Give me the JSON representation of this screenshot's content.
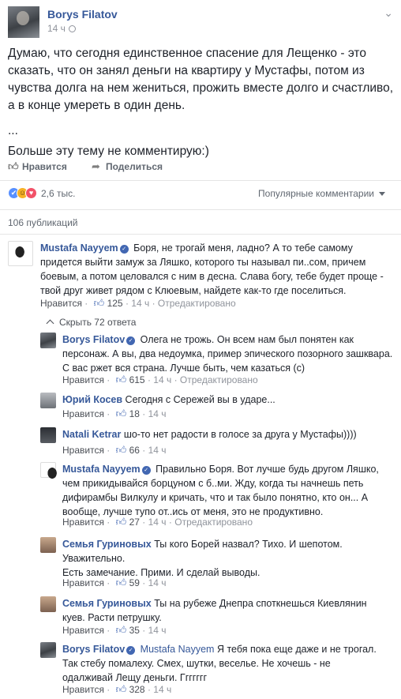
{
  "post": {
    "author": "Borys Filatov",
    "time": "14 ч",
    "paragraph1": "Думаю, что сегодня единственное спасение для Лещенко - это сказать, что он занял деньги на квартиру у Мустафы, потом из чувства долга на нем жениться, прожить вместе долго и счастливо, а в конце умереть в один день.",
    "ellipsis": "...",
    "paragraph2": "Больше эту тему не комментирую:)",
    "like_label": "Нравится",
    "share_label": "Поделиться",
    "reactions_count": "2,6 тыс.",
    "sort_label": "Популярные комментарии",
    "publications_label": "106 публикаций"
  },
  "comments": [
    {
      "author": "Mustafa Nayyem",
      "text": "Боря, не трогай меня, ладно? А то тебе самому придется выйти замуж за Ляшко, которого ты называл пи..сом, причем боевым, а потом целовался с ним в десна. Слава богу, тебе будет проще - твой друг живет рядом с Клюевым, найдете как-то где поселиться.",
      "like": "Нравится",
      "likes": "125",
      "time": "14 ч",
      "edited": "Отредактировано"
    }
  ],
  "hide_replies_label": "Скрыть 72 ответа",
  "replies": [
    {
      "author": "Borys Filatov",
      "text": "Олега не трожь. Он всем нам был понятен как персонаж. А вы, два недоумка, пример эпического позорного зашквара. С вас ржет вся страна. Лучше быть, чем казаться (с)",
      "like": "Нравится",
      "likes": "615",
      "time": "14 ч",
      "edited": "Отредактировано"
    },
    {
      "author": "Юрий Косев",
      "text": "Сегодня с Сережей вы в ударе...",
      "like": "Нравится",
      "likes": "18",
      "time": "14 ч"
    },
    {
      "author": "Natali Ketrar",
      "text": "шо-то нет радости в голосе за друга у Мустафы))))",
      "like": "Нравится",
      "likes": "66",
      "time": "14 ч"
    },
    {
      "author": "Mustafa Nayyem",
      "text": "Правильно Боря. Вот лучше будь другом Ляшко, чем прикидывайся борцуном с б..ми. Жду, когда ты начнешь петь дифирамбы Вилкулу и кричать, что и так было понятно, кто он... А вообще, лучше тупо от..ись от меня, это не продуктивно.",
      "like": "Нравится",
      "likes": "27",
      "time": "14 ч",
      "edited": "Отредактировано"
    },
    {
      "author": "Семья Гуриновых",
      "text": "Ты кого Борей назвал? Тихо. И шепотом. Уважительно.",
      "text2": "Есть замечание. Прими. И сделай выводы.",
      "like": "Нравится",
      "likes": "59",
      "time": "14 ч"
    },
    {
      "author": "Семья Гуриновых",
      "text": "Ты на рубеже Днепра споткнешься Киевлянин куев. Расти петрушку.",
      "like": "Нравится",
      "likes": "35",
      "time": "14 ч"
    },
    {
      "author": "Borys Filatov",
      "mention": "Mustafa Nayyem",
      "text": "Я тебя пока еще даже и не трогал. Так стебу помалеху. Смех, шутки, веселье. Не хочешь - не одалживай Лещу деньги. Ггггггг",
      "like": "Нравится",
      "likes": "328",
      "time": "14 ч"
    }
  ],
  "meta_sep": "·",
  "icons": {
    "globe": "globe-icon",
    "chevron": "chevron-down-icon",
    "like": "thumbs-up-icon",
    "share": "share-arrow-icon",
    "verified": "verified-badge-icon"
  },
  "colors": {
    "link": "#365899",
    "meta": "#90949c",
    "like_blue": "#4267b2"
  }
}
